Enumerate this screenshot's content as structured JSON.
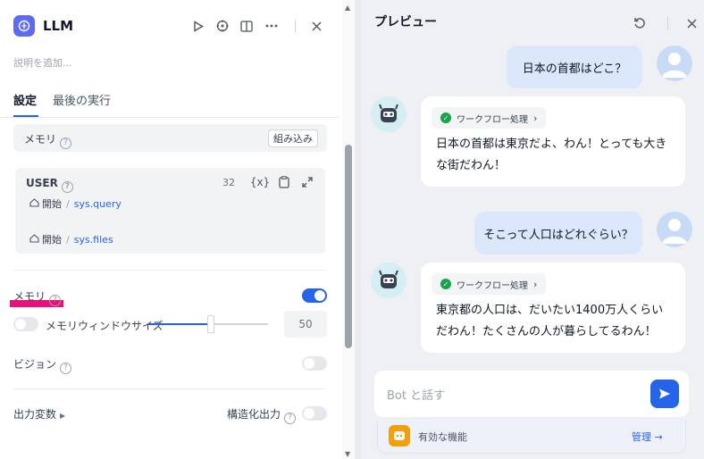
{
  "left": {
    "title": "LLM",
    "description_placeholder": "説明を追加...",
    "tabs": [
      {
        "label": "設定"
      },
      {
        "label": "最後の実行"
      }
    ],
    "memory_section": {
      "label": "メモリ",
      "embed_button": "組み込み"
    },
    "user_prompt": {
      "label": "USER",
      "count": "32",
      "variables": [
        {
          "node": "開始",
          "var": "sys.query"
        },
        {
          "node": "開始",
          "var": "sys.files"
        }
      ]
    },
    "memory_toggle": {
      "label": "メモリ",
      "enabled": true
    },
    "memory_window": {
      "label": "メモリウィンドウサイズ",
      "value": "50",
      "enabled": false,
      "slider_fraction": 0.5
    },
    "vision": {
      "label": "ビジョン",
      "enabled": false
    },
    "output_vars": {
      "label": "出力変数",
      "structured_label": "構造化出力",
      "structured_enabled": false
    }
  },
  "right": {
    "title": "プレビュー",
    "messages": [
      {
        "role": "user",
        "text": "日本の首都はどこ？"
      },
      {
        "role": "bot",
        "workflow_label": "ワークフロー処理",
        "lines": [
          "日本の首都は東京だよ、わん！とっても大き",
          "な街だわん！"
        ]
      },
      {
        "role": "user",
        "text": "そこって人口はどれぐらい？"
      },
      {
        "role": "bot",
        "workflow_label": "ワークフロー処理",
        "lines": [
          "東京都の人口は、だいたい1400万人くらい",
          "だわん！たくさんの人が暮らしてるわん！"
        ]
      }
    ],
    "input_placeholder": "Bot と話す",
    "features_label": "有効な機能",
    "manage_label": "管理 →"
  },
  "colors": {
    "accent": "#2563eb",
    "highlight": "#e6127a",
    "logo": "#5b6cf0",
    "success": "#16a34a"
  }
}
